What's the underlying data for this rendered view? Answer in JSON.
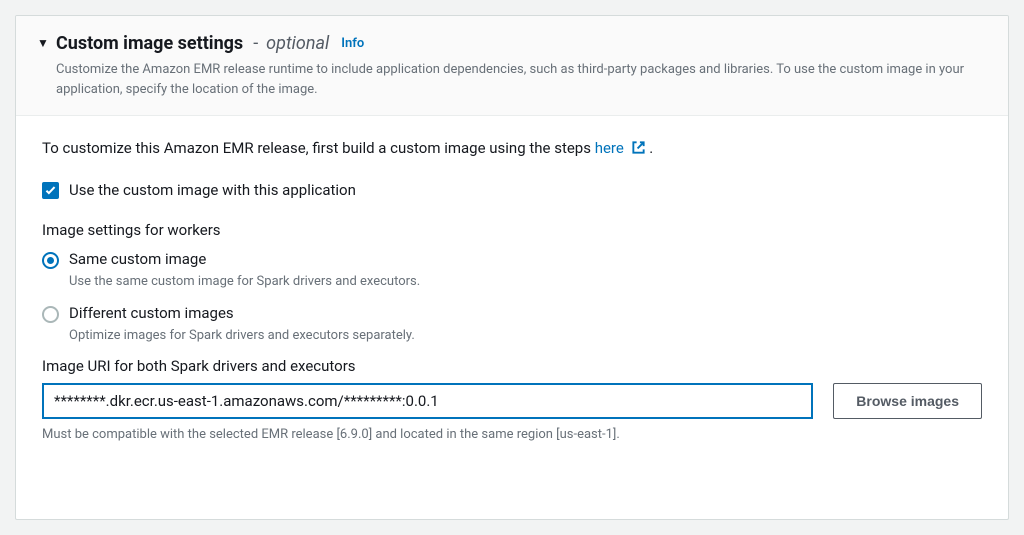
{
  "header": {
    "title": "Custom image settings",
    "dash": "-",
    "optional": "optional",
    "info": "Info",
    "description": "Customize the Amazon EMR release runtime to include application dependencies, such as third-party packages and libraries. To use the custom image in your application, specify the location of the image."
  },
  "instruction": {
    "prefix": "To customize this Amazon EMR release, first build a custom image using the steps ",
    "link_text": "here",
    "suffix": " ."
  },
  "checkbox": {
    "label": "Use the custom image with this application",
    "checked": true
  },
  "workers_label": "Image settings for workers",
  "radio": {
    "same": {
      "label": "Same custom image",
      "desc": "Use the same custom image for Spark drivers and executors."
    },
    "different": {
      "label": "Different custom images",
      "desc": "Optimize images for Spark drivers and executors separately."
    },
    "selected": "same"
  },
  "uri": {
    "label": "Image URI for both Spark drivers and executors",
    "value": "********.dkr.ecr.us-east-1.amazonaws.com/*********:0.0.1",
    "hint": "Must be compatible with the selected EMR release [6.9.0] and located in the same region [us-east-1]."
  },
  "browse_button": "Browse images"
}
